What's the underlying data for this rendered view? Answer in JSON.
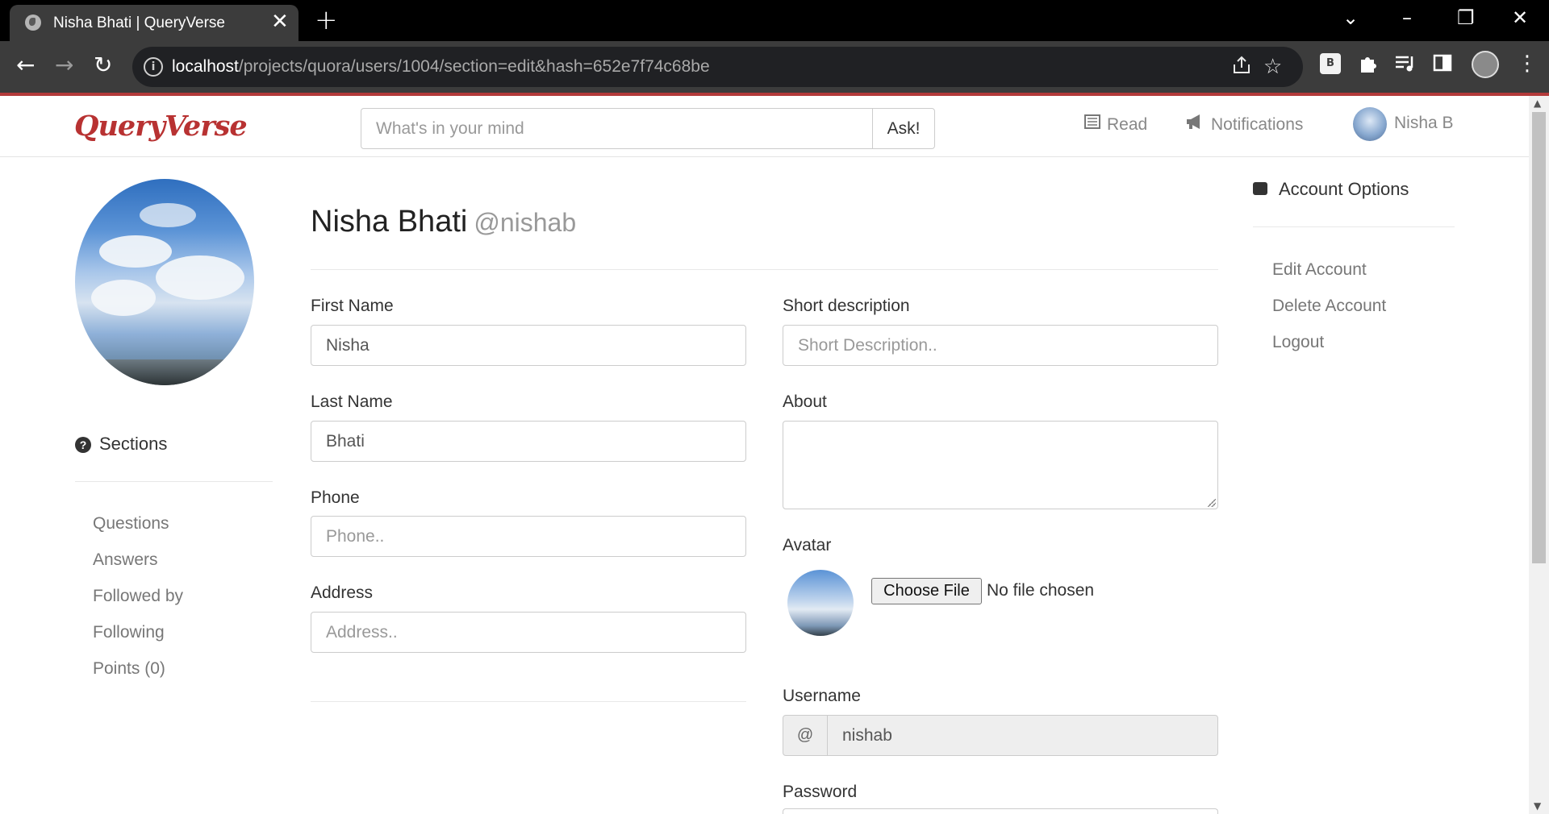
{
  "browser": {
    "tab_title": "Nisha Bhati | QueryVerse",
    "tab_close": "✕",
    "new_tab": "+",
    "url_host": "localhost",
    "url_path": "/projects/quora/users/1004/section=edit&hash=652e7f74c68be",
    "ext_badge": "B",
    "window_controls": {
      "dropdown": "⌄",
      "minimize": "–",
      "restore": "❐",
      "close": "✕"
    },
    "nav": {
      "back": "←",
      "forward": "→",
      "reload": "↻"
    },
    "icons": [
      "info-icon",
      "share-icon",
      "star-icon",
      "extensions-icon",
      "media-icon",
      "sidepanel-icon",
      "menu-icon"
    ]
  },
  "header": {
    "logo": "QueryVerse",
    "search_placeholder": "What's in your mind",
    "ask_label": "Ask!",
    "nav_read": "Read",
    "nav_notifications": "Notifications",
    "nav_user": "Nisha B"
  },
  "left": {
    "sections_heading": "Sections",
    "links": [
      "Questions",
      "Answers",
      "Followed by",
      "Following",
      "Points (0)"
    ]
  },
  "profile": {
    "full_name": "Nisha Bhati",
    "username_tag": "@nishab"
  },
  "form": {
    "first_name_label": "First Name",
    "first_name_value": "Nisha",
    "last_name_label": "Last Name",
    "last_name_value": "Bhati",
    "phone_label": "Phone",
    "phone_placeholder": "Phone..",
    "address_label": "Address",
    "address_placeholder": "Address..",
    "short_desc_label": "Short description",
    "short_desc_placeholder": "Short Description..",
    "about_label": "About",
    "avatar_label": "Avatar",
    "choose_file_label": "Choose File",
    "no_file_text": "No file chosen",
    "username_label": "Username",
    "username_addon": "@",
    "username_value": "nishab",
    "password_label": "Password"
  },
  "right": {
    "account_heading": "Account Options",
    "links": [
      "Edit Account",
      "Delete Account",
      "Logout"
    ]
  },
  "colors": {
    "brand": "#b83232",
    "chrome_dark": "#3c3c3c",
    "accent_line": "#b33a3a"
  }
}
